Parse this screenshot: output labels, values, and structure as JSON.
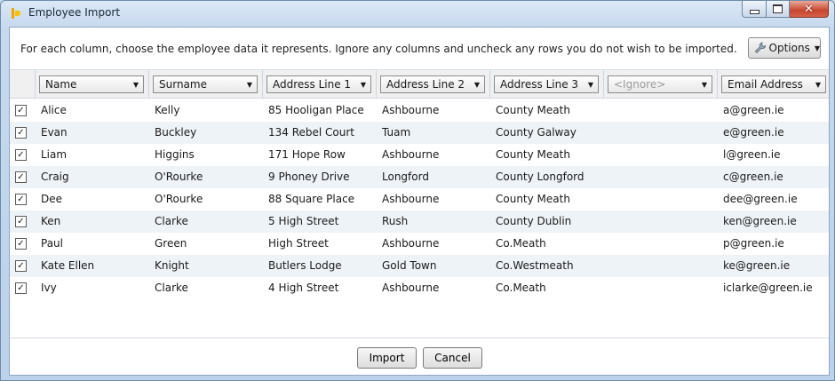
{
  "window": {
    "title": "Employee Import",
    "app_icon": "app-logo-icon"
  },
  "instructions": "For each column, choose the employee data it represents. Ignore any columns and uncheck any rows you do not wish to be imported.",
  "options_label": "Options",
  "columns": [
    "Name",
    "Surname",
    "Address Line 1",
    "Address Line 2",
    "Address Line 3",
    "<Ignore>",
    "Email Address"
  ],
  "rows": [
    {
      "checked": true,
      "cells": [
        "Alice",
        "Kelly",
        "85 Hooligan Place",
        "Ashbourne",
        "County Meath",
        "",
        "a@green.ie"
      ]
    },
    {
      "checked": true,
      "cells": [
        "Evan",
        "Buckley",
        "134 Rebel Court",
        "Tuam",
        "County Galway",
        "",
        "e@green.ie"
      ]
    },
    {
      "checked": true,
      "cells": [
        "Liam",
        "Higgins",
        "171 Hope Row",
        "Ashbourne",
        "County Meath",
        "",
        "l@green.ie"
      ]
    },
    {
      "checked": true,
      "cells": [
        "Craig",
        "O'Rourke",
        "9 Phoney Drive",
        "Longford",
        "County Longford",
        "",
        "c@green.ie"
      ]
    },
    {
      "checked": true,
      "cells": [
        "Dee",
        "O'Rourke",
        "88 Square Place",
        "Ashbourne",
        "County Meath",
        "",
        "dee@green.ie"
      ]
    },
    {
      "checked": true,
      "cells": [
        "Ken",
        "Clarke",
        "5 High Street",
        "Rush",
        "County Dublin",
        "",
        "ken@green.ie"
      ]
    },
    {
      "checked": true,
      "cells": [
        "Paul",
        "Green",
        "High Street",
        "Ashbourne",
        "Co.Meath",
        "",
        "p@green.ie"
      ]
    },
    {
      "checked": true,
      "cells": [
        "Kate Ellen",
        "Knight",
        "Butlers Lodge",
        "Gold Town",
        "Co.Westmeath",
        "",
        "ke@green.ie"
      ]
    },
    {
      "checked": true,
      "cells": [
        "Ivy",
        "Clarke",
        "4 High Street",
        "Ashbourne",
        "Co.Meath",
        "",
        "iclarke@green.ie"
      ]
    }
  ],
  "buttons": {
    "import": "Import",
    "cancel": "Cancel"
  },
  "colors": {
    "title_bg": "#c6d9ee",
    "alt_row": "#eef3f8",
    "close_button": "#c8472f"
  }
}
